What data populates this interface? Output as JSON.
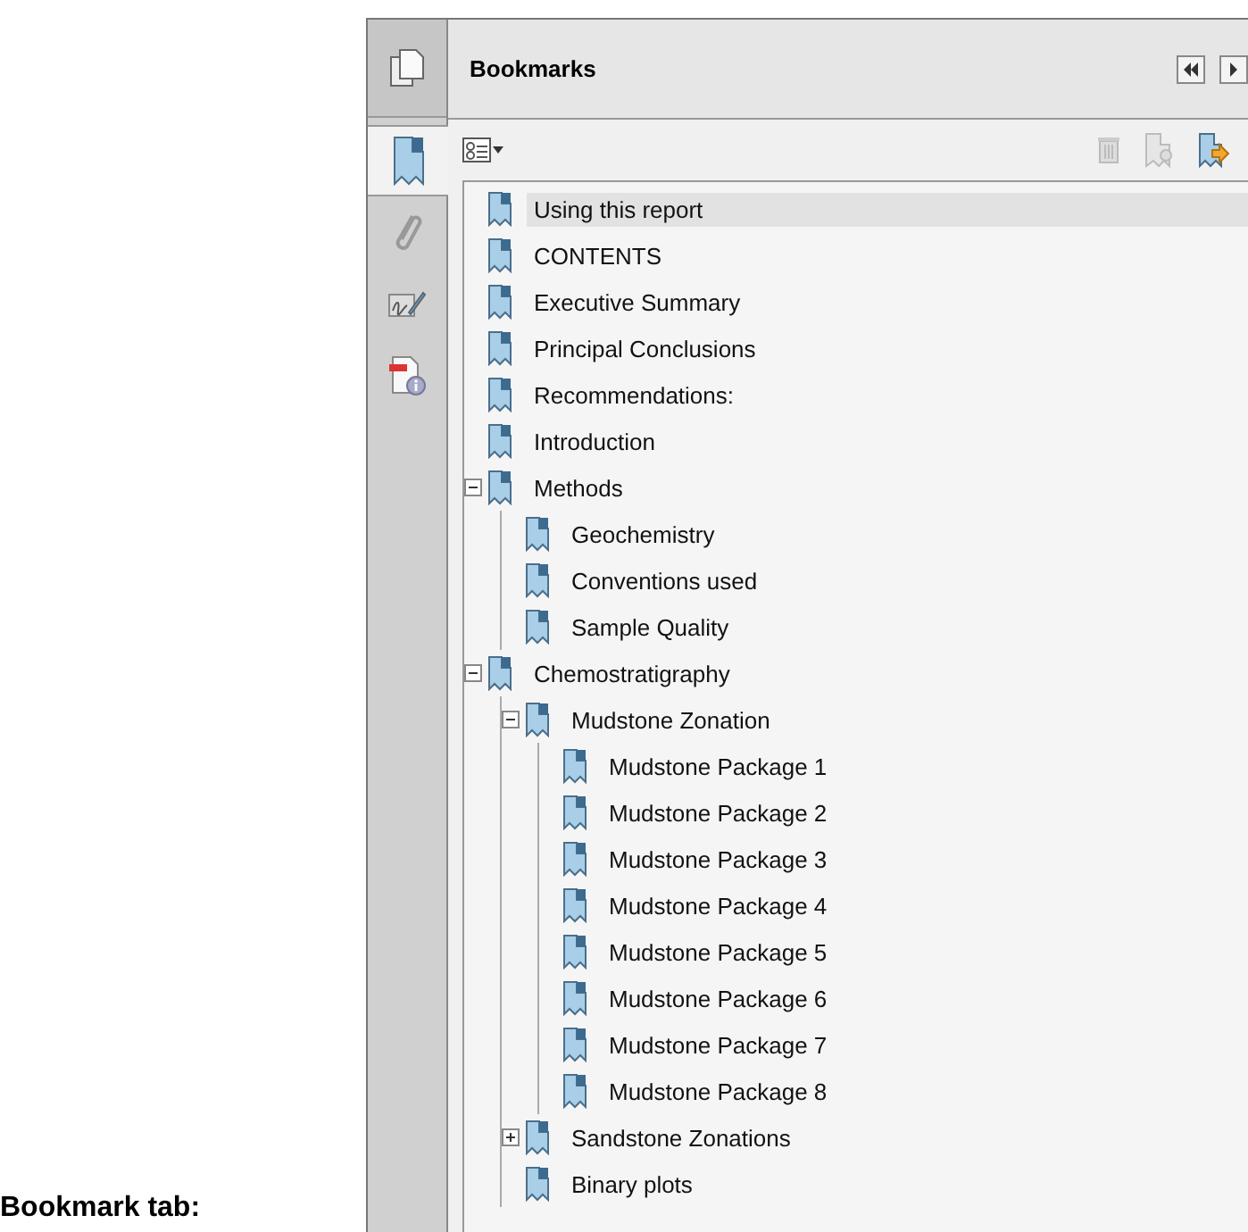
{
  "caption": "Bookmark tab:",
  "side_tabs": [
    {
      "kind": "pages",
      "selected": false
    },
    {
      "kind": "bookmarks",
      "selected": true
    },
    {
      "kind": "attachments",
      "selected": false
    },
    {
      "kind": "signatures",
      "selected": false
    },
    {
      "kind": "info",
      "selected": false
    }
  ],
  "panel": {
    "title": "Bookmarks"
  },
  "bookmarks": [
    {
      "label": "Using this report",
      "selected": true
    },
    {
      "label": "CONTENTS",
      "selected": false
    },
    {
      "label": "Executive Summary",
      "selected": false
    },
    {
      "label": "Principal Conclusions",
      "selected": false
    },
    {
      "label": "Recommendations:",
      "selected": false
    },
    {
      "label": "Introduction",
      "selected": false
    },
    {
      "label": "Methods",
      "selected": false,
      "expanded": true,
      "children": [
        {
          "label": "Geochemistry",
          "selected": false
        },
        {
          "label": "Conventions used",
          "selected": false
        },
        {
          "label": "Sample Quality",
          "selected": false
        }
      ]
    },
    {
      "label": "Chemostratigraphy",
      "selected": false,
      "expanded": true,
      "children": [
        {
          "label": "Mudstone Zonation",
          "selected": false,
          "expanded": true,
          "children": [
            {
              "label": "Mudstone Package 1",
              "selected": false
            },
            {
              "label": "Mudstone Package 2",
              "selected": false
            },
            {
              "label": "Mudstone Package 3",
              "selected": false
            },
            {
              "label": "Mudstone Package 4",
              "selected": false
            },
            {
              "label": "Mudstone Package 5",
              "selected": false
            },
            {
              "label": "Mudstone Package 6",
              "selected": false
            },
            {
              "label": "Mudstone Package 7",
              "selected": false
            },
            {
              "label": "Mudstone Package 8",
              "selected": false
            }
          ]
        },
        {
          "label": "Sandstone Zonations",
          "selected": false,
          "expanded": false
        },
        {
          "label": "Binary plots",
          "selected": false
        }
      ]
    }
  ]
}
